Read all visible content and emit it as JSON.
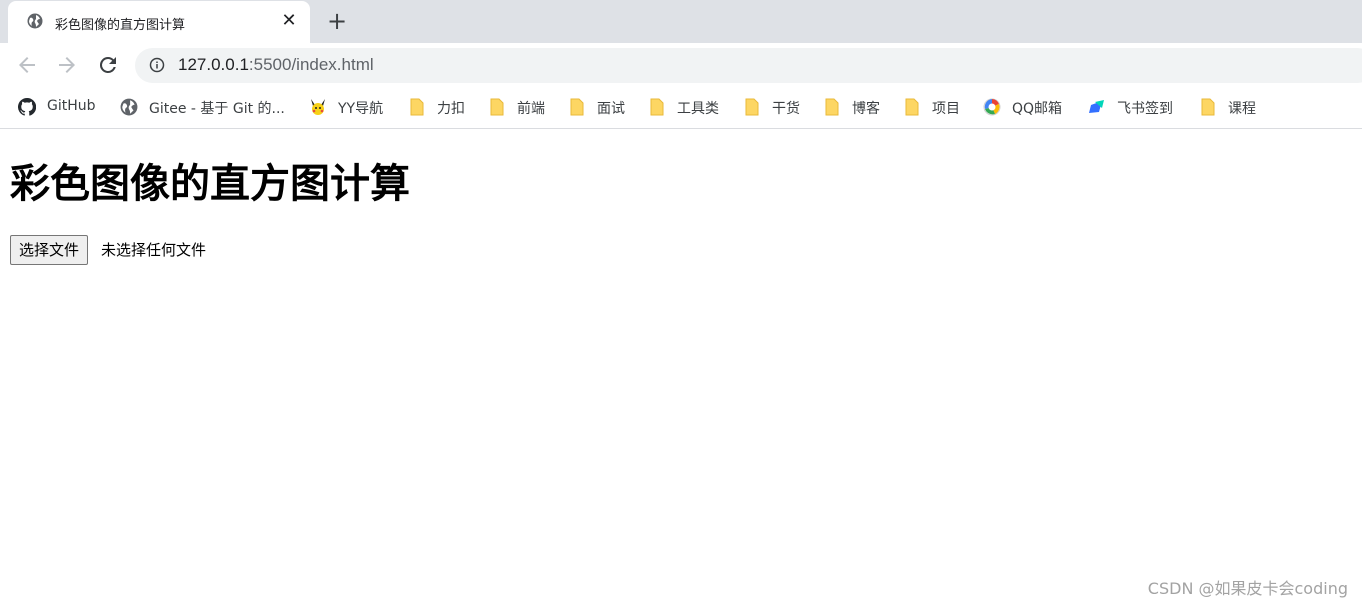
{
  "tab": {
    "title": "彩色图像的直方图计算",
    "close_label": "✕",
    "new_tab_label": "+"
  },
  "toolbar": {
    "url_host": "127.0.0.1",
    "url_path": ":5500/index.html"
  },
  "bookmarks": [
    {
      "label": "GitHub",
      "icon": "github-icon"
    },
    {
      "label": "Gitee - 基于 Git 的...",
      "icon": "globe-icon"
    },
    {
      "label": "YY导航",
      "icon": "pikachu-icon"
    },
    {
      "label": "力扣",
      "icon": "folder-icon"
    },
    {
      "label": "前端",
      "icon": "folder-icon"
    },
    {
      "label": "面试",
      "icon": "folder-icon"
    },
    {
      "label": "工具类",
      "icon": "folder-icon"
    },
    {
      "label": "干货",
      "icon": "folder-icon"
    },
    {
      "label": "博客",
      "icon": "folder-icon"
    },
    {
      "label": "项目",
      "icon": "folder-icon"
    },
    {
      "label": "QQ邮箱",
      "icon": "qqmail-icon"
    },
    {
      "label": "飞书签到",
      "icon": "feishu-icon"
    },
    {
      "label": "课程",
      "icon": "folder-icon"
    }
  ],
  "page": {
    "heading": "彩色图像的直方图计算",
    "file_button_label": "选择文件",
    "file_status": "未选择任何文件"
  },
  "watermark": "CSDN @如果皮卡会coding",
  "colors": {
    "tab_strip": "#dee1e6",
    "omnibox": "#f1f3f4",
    "folder": "#fdd663",
    "text": "#202124"
  }
}
